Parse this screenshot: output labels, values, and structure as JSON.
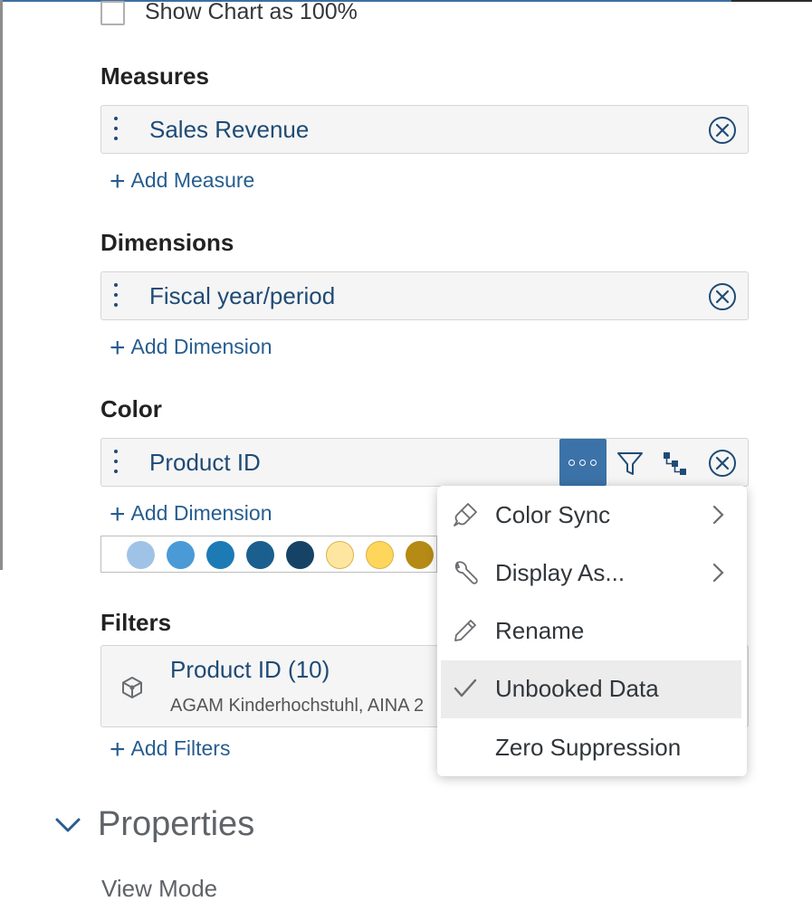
{
  "show_chart_100": {
    "label": "Show Chart as 100%",
    "checked": false
  },
  "measures": {
    "title": "Measures",
    "items": [
      {
        "label": "Sales Revenue"
      }
    ],
    "add_label": "Add Measure"
  },
  "dimensions": {
    "title": "Dimensions",
    "items": [
      {
        "label": "Fiscal year/period"
      }
    ],
    "add_label": "Add Dimension"
  },
  "color": {
    "title": "Color",
    "items": [
      {
        "label": "Product ID"
      }
    ],
    "add_label": "Add Dimension",
    "palette": [
      "#9fc3e7",
      "#4a9ad6",
      "#1c7bb5",
      "#1b5f8e",
      "#164365",
      "#ffe6a0",
      "#ffd65c",
      "#b58a15"
    ]
  },
  "filters": {
    "title": "Filters",
    "items": [
      {
        "label": "Product ID (10)",
        "detail": "AGAM Kinderhochstuhl, AINA 2"
      }
    ],
    "add_label": "Add Filters"
  },
  "context_menu": {
    "items": [
      {
        "label": "Color Sync",
        "icon": "paintbrush-icon",
        "has_submenu": true
      },
      {
        "label": "Display As...",
        "icon": "wrench-icon",
        "has_submenu": true
      },
      {
        "label": "Rename",
        "icon": "pencil-icon",
        "has_submenu": false
      },
      {
        "label": "Unbooked Data",
        "icon": "checkmark-icon",
        "has_submenu": false,
        "checked": true
      },
      {
        "label": "Zero Suppression",
        "icon": "",
        "has_submenu": false
      }
    ]
  },
  "properties": {
    "title": "Properties",
    "view_mode_label": "View Mode"
  },
  "colors": {
    "accent": "#3b72a8",
    "link": "#275d8f",
    "field_text": "#1f4b75"
  }
}
